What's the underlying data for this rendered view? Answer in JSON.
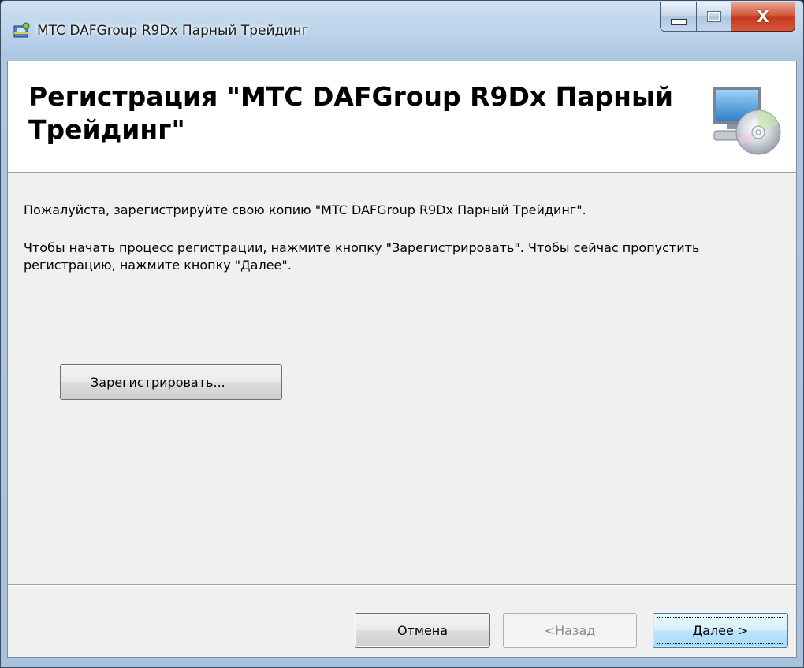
{
  "window": {
    "title": "MTC DAFGroup R9Dx Парный Трейдинг",
    "close_glyph": "X",
    "icons": {
      "app": "installer-icon",
      "banner": "computer-disc-icon"
    }
  },
  "banner": {
    "title": "Регистрация \"MTC DAFGroup R9Dx Парный Трейдинг\""
  },
  "body": {
    "paragraph1": "Пожалуйста, зарегистрируйте свою копию \"MTC DAFGroup R9Dx Парный Трейдинг\".",
    "paragraph2": "Чтобы начать процесс регистрации, нажмите кнопку \"Зарегистрировать\". Чтобы сейчас пропустить регистрацию, нажмите кнопку \"Далее\"."
  },
  "register_button": {
    "accel": "З",
    "rest": "арегистрировать..."
  },
  "footer": {
    "cancel": "Отмена",
    "back_prefix": "< ",
    "back_accel": "Н",
    "back_rest": "азад",
    "next_accel": "Д",
    "next_rest": "алее >"
  },
  "colors": {
    "title_bar": "#bcd3ea",
    "close_button": "#c2381a",
    "dialog_bg": "#f0f0f0",
    "banner_bg": "#ffffff",
    "default_button_border": "#3c7fb1"
  }
}
